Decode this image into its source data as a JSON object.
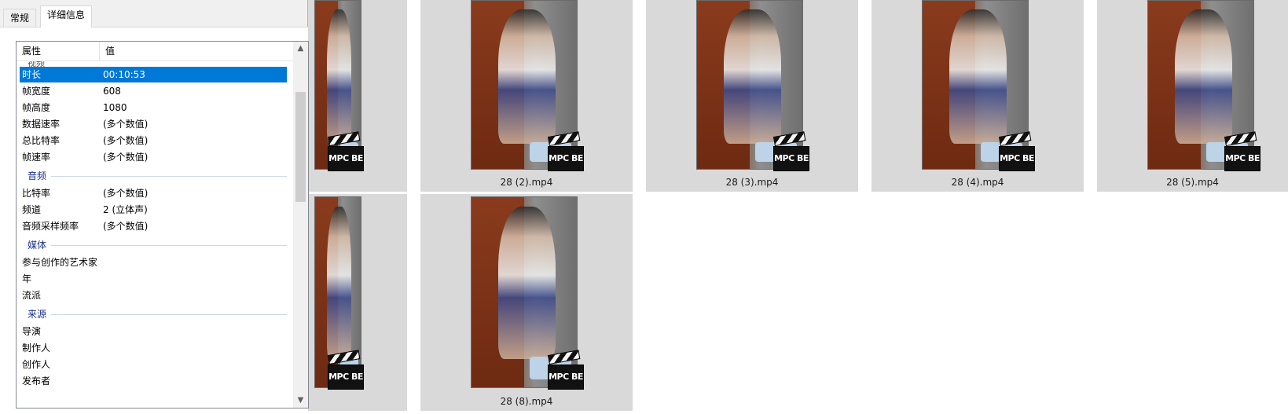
{
  "dialog": {
    "tabs": [
      {
        "label": "常规",
        "active": false
      },
      {
        "label": "详细信息",
        "active": true
      }
    ],
    "columns": {
      "property": "属性",
      "value": "值"
    },
    "clipped_label": "视频",
    "rows": [
      {
        "key": "时长",
        "value": "00:10:53",
        "selected": true
      },
      {
        "key": "帧宽度",
        "value": "608"
      },
      {
        "key": "帧高度",
        "value": "1080"
      },
      {
        "key": "数据速率",
        "value": "(多个数值)"
      },
      {
        "key": "总比特率",
        "value": "(多个数值)"
      },
      {
        "key": "帧速率",
        "value": "(多个数值)"
      },
      {
        "group": "音频"
      },
      {
        "key": "比特率",
        "value": "(多个数值)"
      },
      {
        "key": "频道",
        "value": "2 (立体声)"
      },
      {
        "key": "音频采样频率",
        "value": "(多个数值)"
      },
      {
        "group": "媒体"
      },
      {
        "key": "参与创作的艺术家",
        "value": ""
      },
      {
        "key": "年",
        "value": ""
      },
      {
        "key": "流派",
        "value": ""
      },
      {
        "group": "来源"
      },
      {
        "key": "导演",
        "value": ""
      },
      {
        "key": "制作人",
        "value": ""
      },
      {
        "key": "创作人",
        "value": ""
      },
      {
        "key": "发布者",
        "value": ""
      }
    ],
    "scroll_up_icon": "chevron-up-icon",
    "scroll_down_icon": "chevron-down-icon"
  },
  "explorer": {
    "files": [
      {
        "name": "",
        "badge": "MPC BE"
      },
      {
        "name": "28 (2).mp4",
        "badge": "MPC BE"
      },
      {
        "name": "28 (3).mp4",
        "badge": "MPC BE"
      },
      {
        "name": "28 (4).mp4",
        "badge": "MPC BE"
      },
      {
        "name": "28 (5).mp4",
        "badge": "MPC BE"
      },
      {
        "name": "",
        "badge": "MPC BE"
      },
      {
        "name": "28 (8).mp4",
        "badge": "MPC BE"
      }
    ]
  }
}
